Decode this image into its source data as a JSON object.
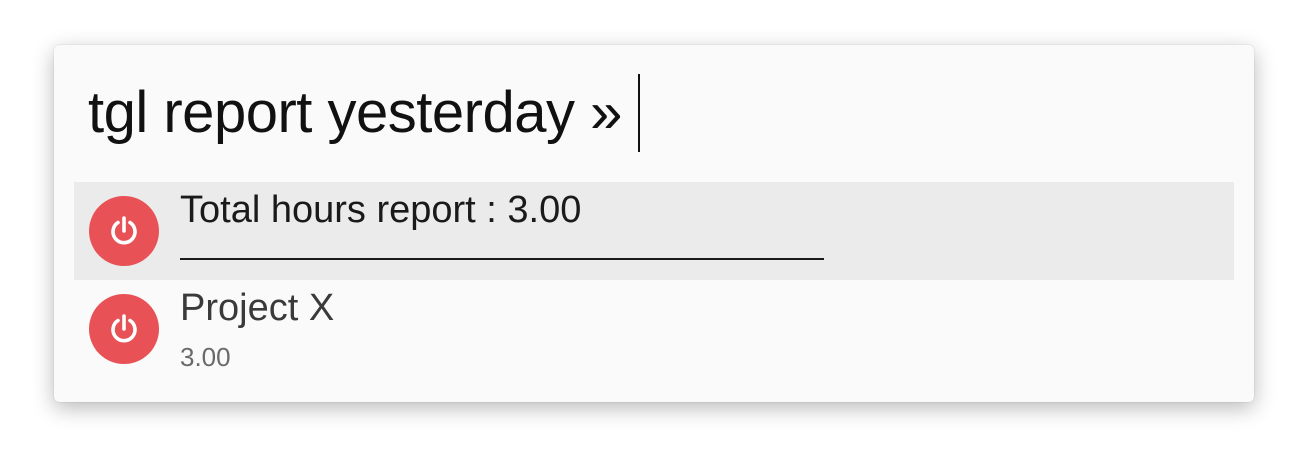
{
  "launcher": {
    "query": "tgl report yesterday »",
    "results": [
      {
        "title": "Total hours report : 3.00",
        "subtitle": "",
        "icon": "power-icon",
        "selected": true
      },
      {
        "title": "Project X",
        "subtitle": "3.00",
        "icon": "power-icon",
        "selected": false
      }
    ]
  },
  "colors": {
    "icon_background": "#e85155",
    "selected_row": "#ebebeb",
    "window_background": "#fafafa"
  }
}
